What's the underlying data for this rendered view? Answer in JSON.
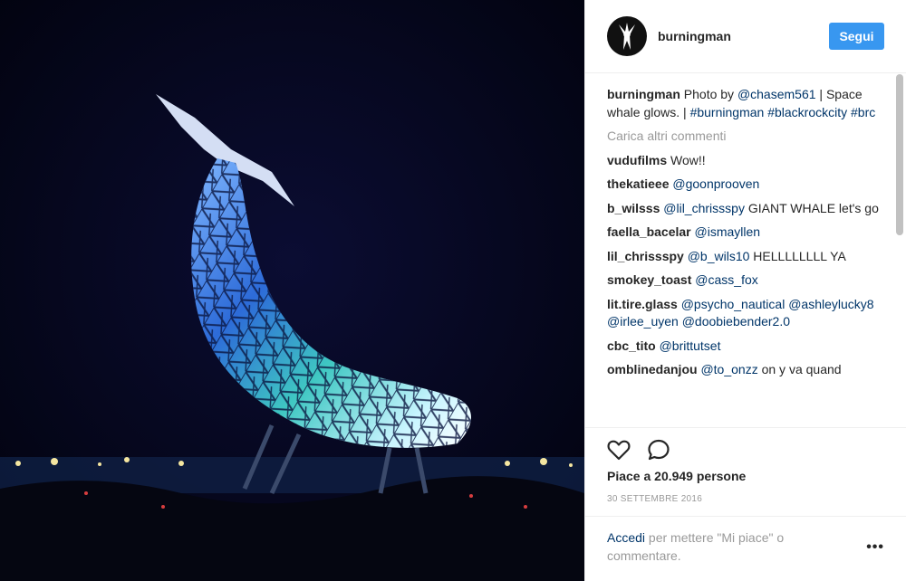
{
  "header": {
    "username": "burningman",
    "follow_label": "Segui"
  },
  "caption": {
    "username": "burningman",
    "text_before": " Photo by ",
    "mention": "@chasem561",
    "text_mid": " | Space whale glows. | ",
    "tag1": "#burningman",
    "space": " ",
    "tag2": "#blackrockcity",
    "tag3": "#brc"
  },
  "load_more": "Carica altri commenti",
  "comments": [
    {
      "user": "vudufilms",
      "text": "Wow!!"
    },
    {
      "user": "thekatieee",
      "mention": "@goonprooven"
    },
    {
      "user": "b_wilsss",
      "mention": "@lil_chrissspy",
      "text": "GIANT WHALE let's go"
    },
    {
      "user": "faella_bacelar",
      "mention": "@ismayllen"
    },
    {
      "user": "lil_chrissspy",
      "mention": "@b_wils10",
      "text": "HELLLLLLLL YA"
    },
    {
      "user": "smokey_toast",
      "mention": "@cass_fox"
    },
    {
      "user": "lit.tire.glass",
      "mention": "@psycho_nautical",
      "mention2": "@ashleylucky8",
      "mention3": "@irlee_uyen",
      "mention4": "@doobiebender2.0"
    },
    {
      "user": "cbc_tito",
      "mention": "@brittutset"
    },
    {
      "user": "omblinedanjou",
      "mention": "@to_onzz",
      "text": "on y va quand"
    }
  ],
  "likes_text": "Piace a 20.949 persone",
  "date": "30 settembre 2016",
  "login": {
    "link": "Accedi",
    "text": " per mettere \"Mi piace\" o commentare."
  },
  "more_options": "•••",
  "icons": [
    "heart-icon",
    "comment-icon",
    "burningman-logo-icon",
    "more-options-icon"
  ],
  "colors": {
    "accent": "#3897f0",
    "link": "#003569",
    "muted": "#999999"
  }
}
